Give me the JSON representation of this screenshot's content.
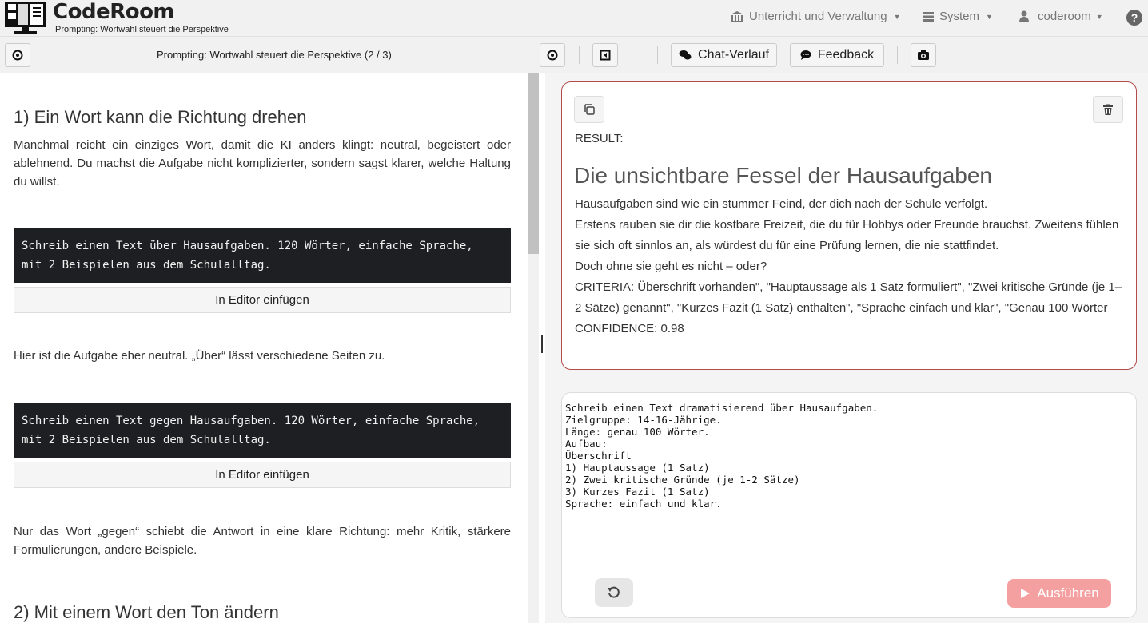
{
  "app": {
    "brand": "CodeRoom",
    "subtitle": "Prompting: Wortwahl steuert die Perspektive"
  },
  "nav": {
    "menu1": "Unterricht und Verwaltung",
    "menu2": "System",
    "user": "coderoom",
    "help": "?"
  },
  "toolbar": {
    "title": "Prompting: Wortwahl steuert die Perspektive (2 / 3)",
    "chat_label": "Chat-Verlauf",
    "feedback_label": "Feedback"
  },
  "lesson": {
    "section1_title": "1) Ein Wort kann die Richtung drehen",
    "section1_intro": "Manchmal reicht ein einziges Wort, damit die KI anders klingt: neutral, begeistert oder ablehnend. Du machst die Aufgabe nicht komplizierter, sondern sagst klarer, welche Haltung du willst.",
    "code1": "Schreib einen Text über Hausaufgaben. 120 Wörter, einfache Sprache,\nmit 2 Beispielen aus dem Schulalltag.",
    "insert_label_1": "In Editor einfügen",
    "note1": "Hier ist die Aufgabe eher neutral. „Über“ lässt verschiedene Seiten zu.",
    "code2": "Schreib einen Text gegen Hausaufgaben. 120 Wörter, einfache Sprache,\nmit 2 Beispielen aus dem Schulalltag.",
    "insert_label_2": "In Editor einfügen",
    "note2": "Nur das Wort „gegen“ schiebt die Antwort in eine klare Richtung: mehr Kritik, stärkere Formulierungen, andere Beispiele.",
    "section2_title": "2) Mit einem Wort den Ton ändern"
  },
  "result": {
    "label": "RESULT:",
    "title": "Die unsichtbare Fessel der Hausaufgaben",
    "line1": "Hausaufgaben sind wie ein stummer Feind, der dich nach der Schule verfolgt.",
    "line2": "Erstens rauben sie dir die kostbare Freizeit, die du für Hobbys oder Freunde brauchst. Zweitens fühlen sie sich oft sinnlos an, als würdest du für eine Prüfung lernen, die nie stattfindet.",
    "line3": "Doch ohne sie geht es nicht – oder?",
    "criteria": "CRITERIA: Überschrift vorhanden\", \"Hauptaussage als 1 Satz formuliert\", \"Zwei kritische Gründe (je 1–2 Sätze) genannt\", \"Kurzes Fazit (1 Satz) enthalten\", \"Sprache einfach und klar\", \"Genau 100 Wörter",
    "confidence": "CONFIDENCE: 0.98"
  },
  "editor": {
    "content": "Schreib einen Text dramatisierend über Hausaufgaben.\nZielgruppe: 14-16-Jährige.\nLänge: genau 100 Wörter.\nAufbau:\nÜberschrift\n1) Hauptaussage (1 Satz)\n2) Zwei kritische Gründe (je 1-2 Sätze)\n3) Kurzes Fazit (1 Satz)\nSprache: einfach und klar.",
    "run_label": "Ausführen"
  }
}
